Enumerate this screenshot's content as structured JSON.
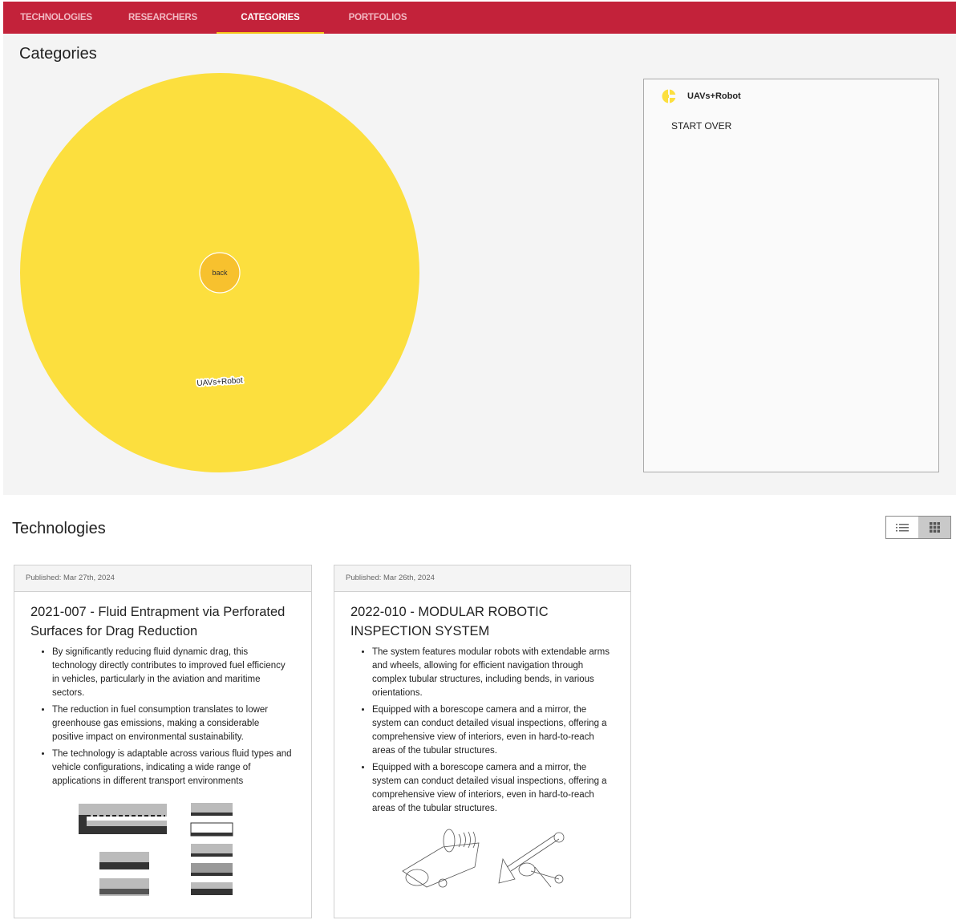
{
  "nav": {
    "tabs": [
      {
        "label": "TECHNOLOGIES",
        "active": false
      },
      {
        "label": "RESEARCHERS",
        "active": false
      },
      {
        "label": "CATEGORIES",
        "active": true
      },
      {
        "label": "PORTFOLIOS",
        "active": false
      }
    ]
  },
  "categories": {
    "title": "Categories",
    "bubble": {
      "label": "UAVs+Robot",
      "back_label": "back",
      "color": "#fcdf3e",
      "back_color": "#f7c12e"
    },
    "panel": {
      "selected_category": "UAVs+Robot",
      "start_over_label": "START OVER"
    }
  },
  "technologies": {
    "title": "Technologies",
    "view_toggle": {
      "list_icon": "list-icon",
      "grid_icon": "grid-icon",
      "active": "grid"
    },
    "cards": [
      {
        "published": "Published: Mar 27th, 2024",
        "title": "2021-007 - Fluid Entrapment via Perforated Surfaces for Drag Reduction",
        "bullets": [
          "By significantly reducing fluid dynamic drag, this technology directly contributes to improved fuel efficiency in vehicles, particularly in the aviation and maritime sectors.",
          "The reduction in fuel consumption translates to lower greenhouse gas emissions, making a considerable positive impact on environmental sustainability.",
          "The technology is adaptable across various fluid types and vehicle configurations, indicating a wide range of applications in different transport environments"
        ],
        "image": "patent-drawing-perforated-surfaces"
      },
      {
        "published": "Published: Mar 26th, 2024",
        "title": "2022-010 - MODULAR ROBOTIC INSPECTION SYSTEM",
        "bullets": [
          "The system features modular robots with extendable arms and wheels, allowing for efficient navigation through complex tubular structures, including bends, in various orientations.",
          "Equipped with a borescope camera and a mirror, the system can conduct detailed visual inspections, offering a comprehensive view of interiors, even in hard-to-reach areas of the tubular structures.",
          "Equipped with a borescope camera and a mirror, the system can conduct detailed visual inspections, offering a comprehensive view of interiors, even in hard-to-reach areas of the tubular structures."
        ],
        "image": "patent-drawing-robotic-inspection"
      }
    ]
  }
}
